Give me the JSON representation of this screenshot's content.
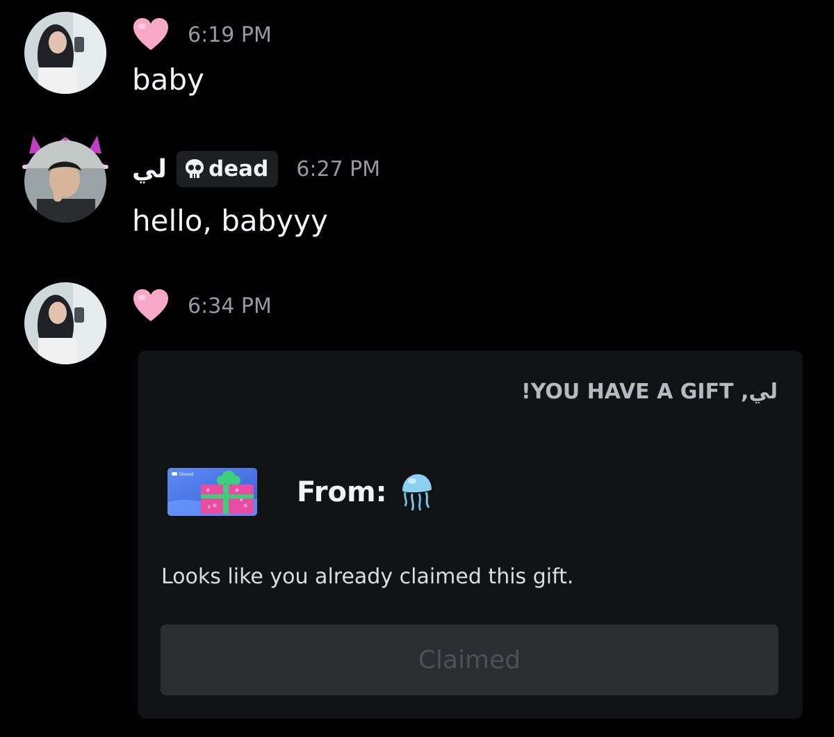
{
  "messages": [
    {
      "author_icon": "pink-heart-emoji",
      "timestamp": "6:19 PM",
      "text": "baby"
    },
    {
      "author_name": "لي",
      "tag": {
        "icon": "skull-icon",
        "label": "dead"
      },
      "timestamp": "6:27 PM",
      "text": "hello, babyyy"
    },
    {
      "author_icon": "pink-heart-emoji",
      "timestamp": "6:34 PM",
      "gift": {
        "title": "!YOU HAVE A GIFT ,لي",
        "card_brand": "Discord",
        "from_label": "From:",
        "from_icon": "jellyfish-emoji",
        "description": "Looks like you already claimed this gift.",
        "button_label": "Claimed"
      }
    }
  ],
  "colors": {
    "background": "#000000",
    "embed_bg": "#111214",
    "timestamp": "#949ba4",
    "button_bg": "#2b2d31",
    "button_text": "#4e5058",
    "heart": "#f9a8c7"
  }
}
